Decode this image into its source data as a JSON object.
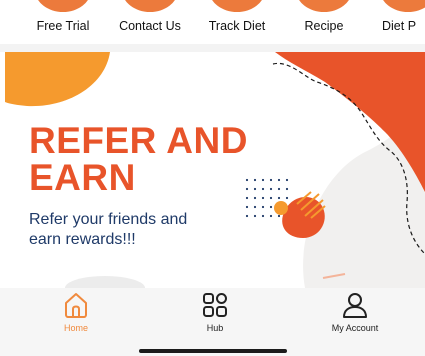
{
  "quick_actions": [
    {
      "label": "Free Trial"
    },
    {
      "label": "Contact Us"
    },
    {
      "label": "Track Diet"
    },
    {
      "label": "Recipe"
    },
    {
      "label": "Diet P"
    }
  ],
  "banner": {
    "title_line1": "REFER AND",
    "title_line2": "EARN",
    "subtitle_line1": "Refer your friends and",
    "subtitle_line2": "earn rewards!!!"
  },
  "nav": {
    "home": "Home",
    "hub": "Hub",
    "account": "My Account"
  },
  "colors": {
    "accent": "#e8542a",
    "orange": "#f08a3e",
    "text_dark": "#1f3a68"
  }
}
